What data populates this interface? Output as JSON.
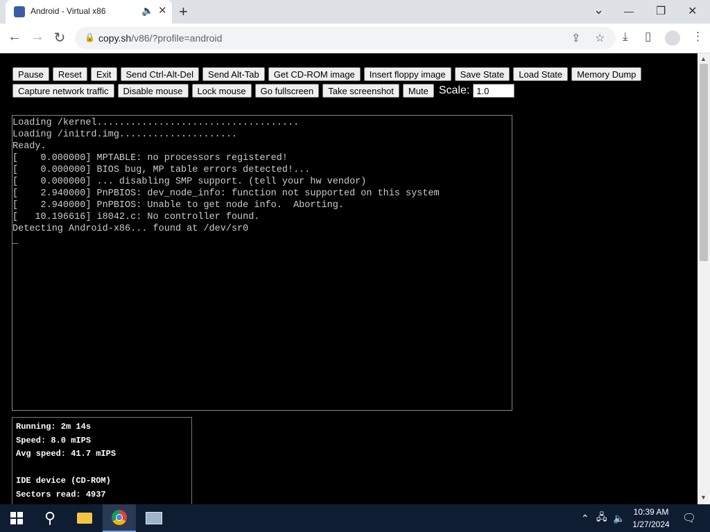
{
  "browser": {
    "tab_title": "Android - Virtual x86",
    "url_host": "copy.sh",
    "url_path": "/v86/?profile=android",
    "new_tab": "+",
    "close_tab": "✕",
    "speaker": "🔈",
    "back": "←",
    "forward": "→",
    "reload": "↻",
    "lock": "🔒",
    "share": "⇪",
    "star": "☆",
    "download": "⤓",
    "sidepanel": "▯",
    "menu": "⋮",
    "chevron": "⌄",
    "minimize": "—",
    "restore": "❐",
    "close": "✕"
  },
  "controls": {
    "row1": [
      "Pause",
      "Reset",
      "Exit",
      "Send Ctrl-Alt-Del",
      "Send Alt-Tab",
      "Get CD-ROM image",
      "Insert floppy image",
      "Save State",
      "Load State",
      "Memory Dump"
    ],
    "row2": [
      "Capture network traffic",
      "Disable mouse",
      "Lock mouse",
      "Go fullscreen",
      "Take screenshot",
      "Mute"
    ],
    "scale_label": "Scale:",
    "scale_value": "1.0"
  },
  "console": {
    "lines": [
      "Loading /kernel....................................",
      "Loading /initrd.img.....................",
      "Ready.",
      "[    0.000000] MPTABLE: no processors registered!",
      "[    0.000000] BIOS bug, MP table errors detected!...",
      "[    0.000000] ... disabling SMP support. (tell your hw vendor)",
      "[    2.940000] PnPBIOS: dev_node_info: function not supported on this system",
      "[    2.940000] PnPBIOS: Unable to get node info.  Aborting.",
      "[   10.196616] i8042.c: No controller found.",
      "Detecting Android-x86... found at /dev/sr0"
    ],
    "cursor": "_"
  },
  "stats": {
    "running": "Running: 2m 14s",
    "speed": "Speed: 8.0 mIPS",
    "avg_speed": "Avg speed: 41.7 mIPS",
    "ide_heading": "IDE device (CD-ROM)",
    "sectors_read": "Sectors read: 4937"
  },
  "taskbar": {
    "time": "10:39 AM",
    "date": "1/27/2024",
    "search_icon": "⚲",
    "tray_chevron": "⌃",
    "network": "🖧",
    "volume": "🔈",
    "notification": "🗨"
  }
}
